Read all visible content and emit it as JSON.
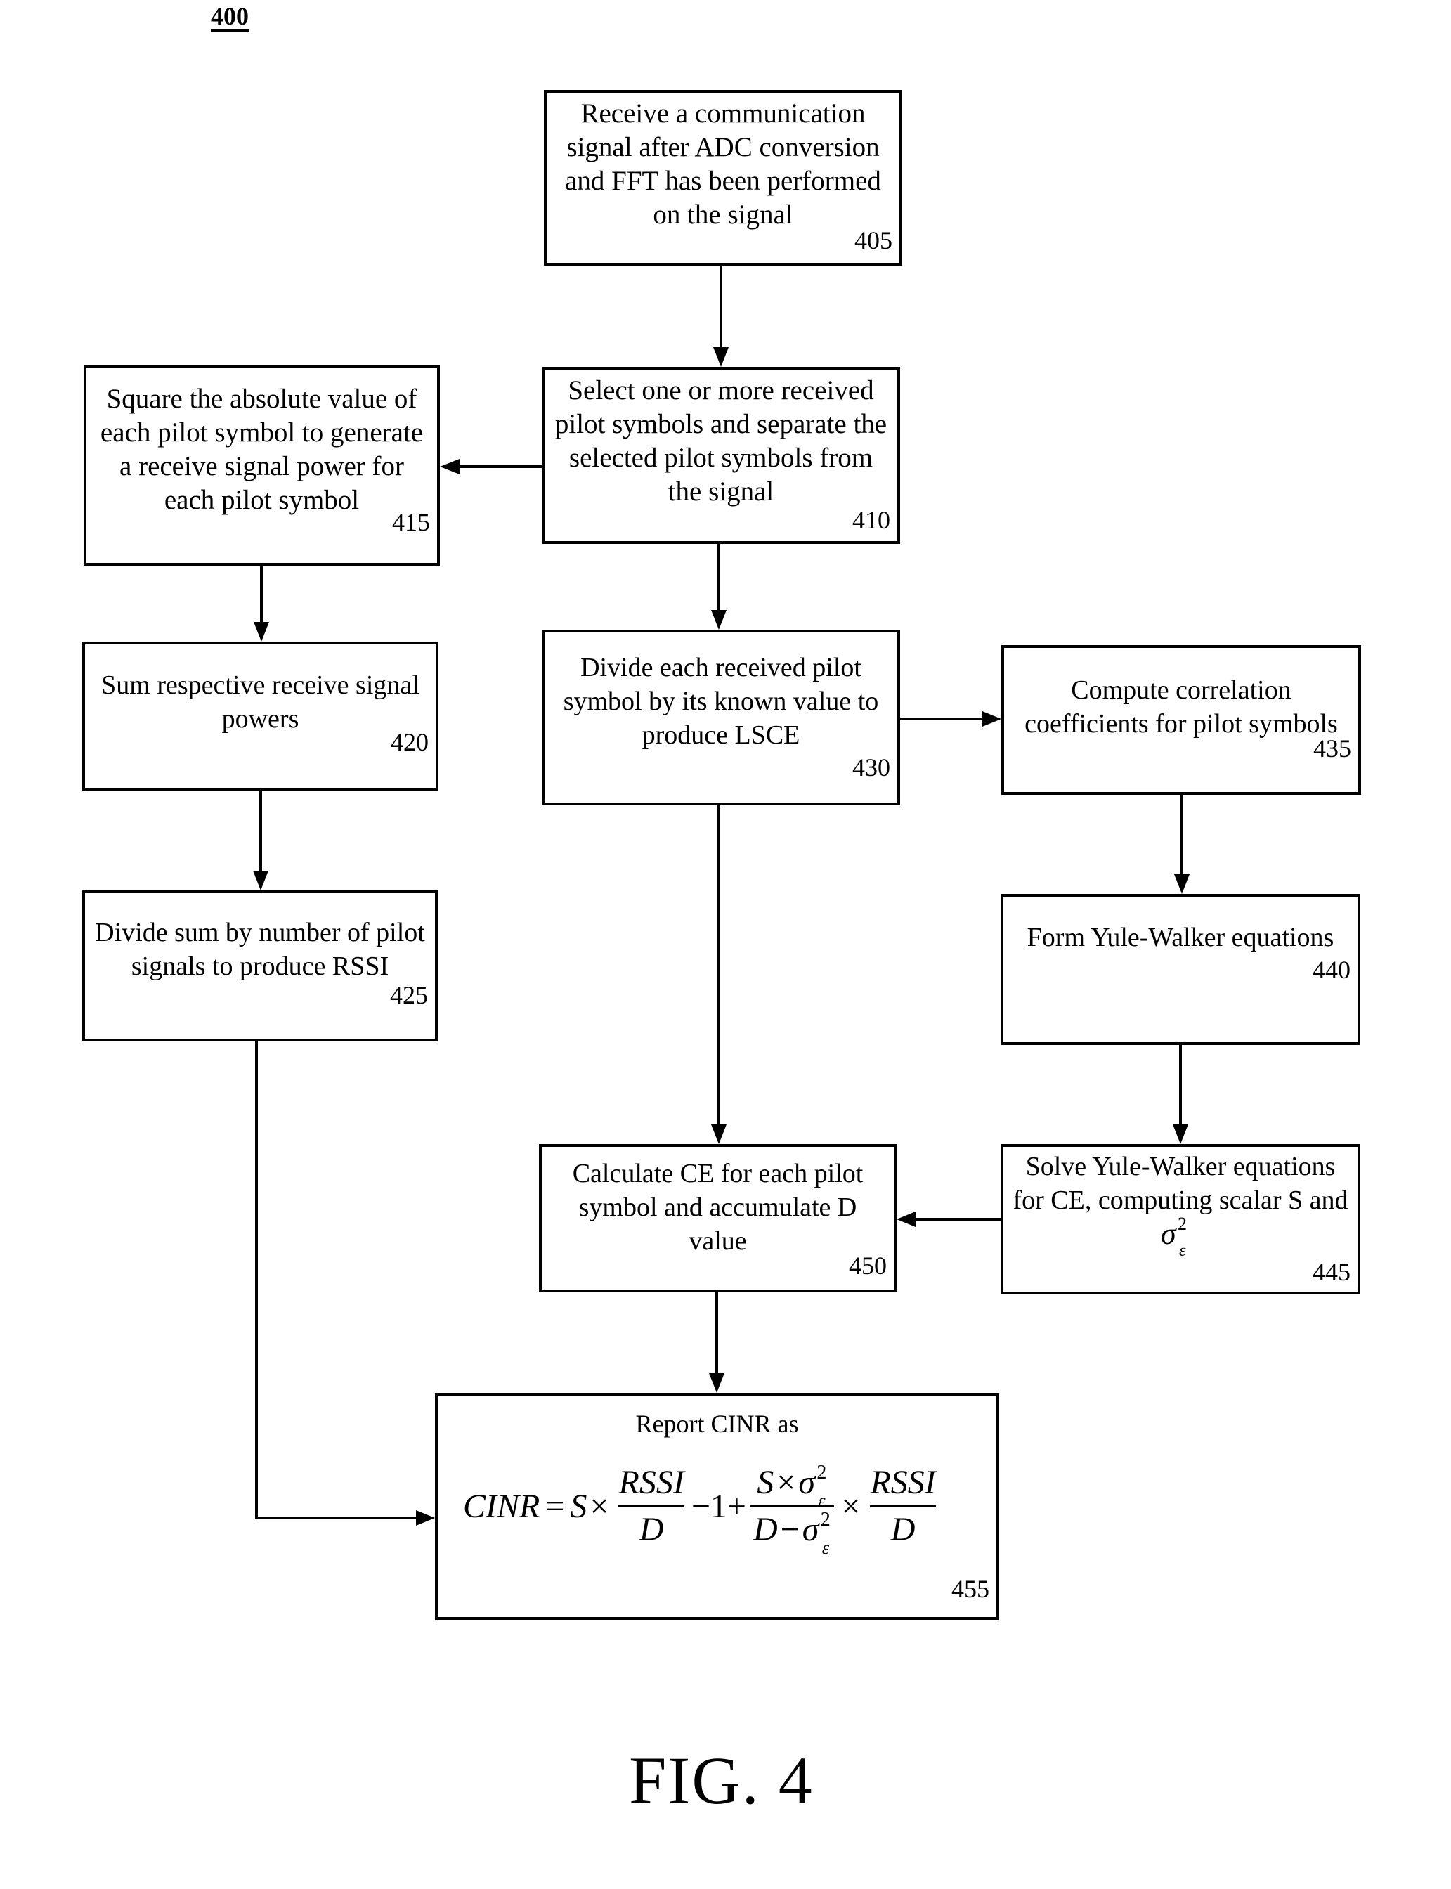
{
  "figure": {
    "reference_number": "400",
    "label": "FIG. 4"
  },
  "steps": [
    {
      "id": "405",
      "text": "Receive a communication signal after ADC conversion and FFT has been performed on the signal"
    },
    {
      "id": "410",
      "text": "Select one or more received pilot symbols and separate the selected pilot symbols from the signal"
    },
    {
      "id": "415",
      "text": "Square the absolute value of each pilot symbol to generate a receive signal power for each pilot symbol"
    },
    {
      "id": "420",
      "text": "Sum respective receive signal powers"
    },
    {
      "id": "425",
      "text": "Divide sum by number of pilot signals to produce RSSI"
    },
    {
      "id": "430",
      "text": "Divide each received pilot symbol by its known value to produce LSCE"
    },
    {
      "id": "435",
      "text": "Compute correlation coefficients for pilot symbols"
    },
    {
      "id": "440",
      "text": "Form Yule-Walker equations"
    },
    {
      "id": "445",
      "text_before_symbol": "Solve Yule-Walker equations for CE, computing scalar S and",
      "symbol": "σ",
      "symbol_sup": "2",
      "symbol_sub": "ε"
    },
    {
      "id": "450",
      "text": "Calculate CE for each pilot symbol and accumulate D value"
    },
    {
      "id": "455",
      "title": "Report CINR as",
      "formula": {
        "lhs": "CINR",
        "eq": "=",
        "s": "S",
        "times": "×",
        "rssi": "RSSI",
        "d": "D",
        "minus_one": "−1+",
        "sigma": "σ",
        "sup": "2",
        "sub": "ε",
        "minus": "−"
      }
    }
  ],
  "connections": [
    {
      "from": "405",
      "to": "410"
    },
    {
      "from": "410",
      "to": "415"
    },
    {
      "from": "410",
      "to": "430"
    },
    {
      "from": "415",
      "to": "420"
    },
    {
      "from": "420",
      "to": "425"
    },
    {
      "from": "425",
      "to": "455"
    },
    {
      "from": "430",
      "to": "435"
    },
    {
      "from": "430",
      "to": "450"
    },
    {
      "from": "435",
      "to": "440"
    },
    {
      "from": "440",
      "to": "445"
    },
    {
      "from": "445",
      "to": "450"
    },
    {
      "from": "450",
      "to": "455"
    }
  ]
}
